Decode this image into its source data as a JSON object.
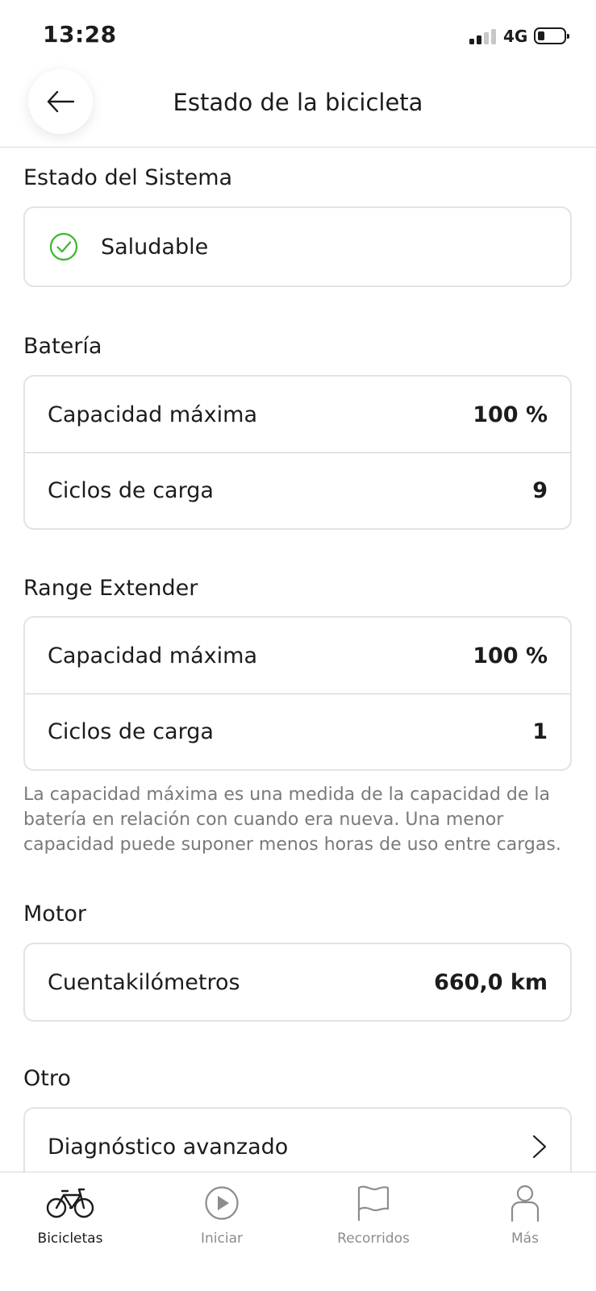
{
  "status_bar": {
    "time": "13:28",
    "network": "4G",
    "signal_bars": 2,
    "battery_level": 0.2
  },
  "header": {
    "title": "Estado de la bicicleta",
    "back_icon": "arrow-left-icon"
  },
  "system": {
    "title": "Estado del Sistema",
    "status_label": "Saludable",
    "status_icon": "check-circle-icon",
    "status_color": "#3cb72e"
  },
  "battery": {
    "title": "Batería",
    "rows": [
      {
        "label": "Capacidad máxima",
        "value": "100 %"
      },
      {
        "label": "Ciclos de carga",
        "value": "9"
      }
    ]
  },
  "range_extender": {
    "title": "Range Extender",
    "rows": [
      {
        "label": "Capacidad máxima",
        "value": "100 %"
      },
      {
        "label": "Ciclos de carga",
        "value": "1"
      }
    ],
    "note": "La capacidad máxima es una medida de la capacidad de la batería en relación con cuando era nueva. Una menor capacidad puede suponer menos horas de uso entre cargas."
  },
  "motor": {
    "title": "Motor",
    "rows": [
      {
        "label": "Cuentakilómetros",
        "value": "660,0 km"
      }
    ]
  },
  "other": {
    "title": "Otro",
    "rows": [
      {
        "label": "Diagnóstico avanzado",
        "icon": "chevron-right-icon"
      }
    ]
  },
  "tabbar": {
    "tabs": [
      {
        "label": "Bicicletas",
        "icon": "bicycle-icon",
        "active": true
      },
      {
        "label": "Iniciar",
        "icon": "play-circle-icon",
        "active": false
      },
      {
        "label": "Recorridos",
        "icon": "flag-icon",
        "active": false
      },
      {
        "label": "Más",
        "icon": "person-icon",
        "active": false
      }
    ]
  }
}
